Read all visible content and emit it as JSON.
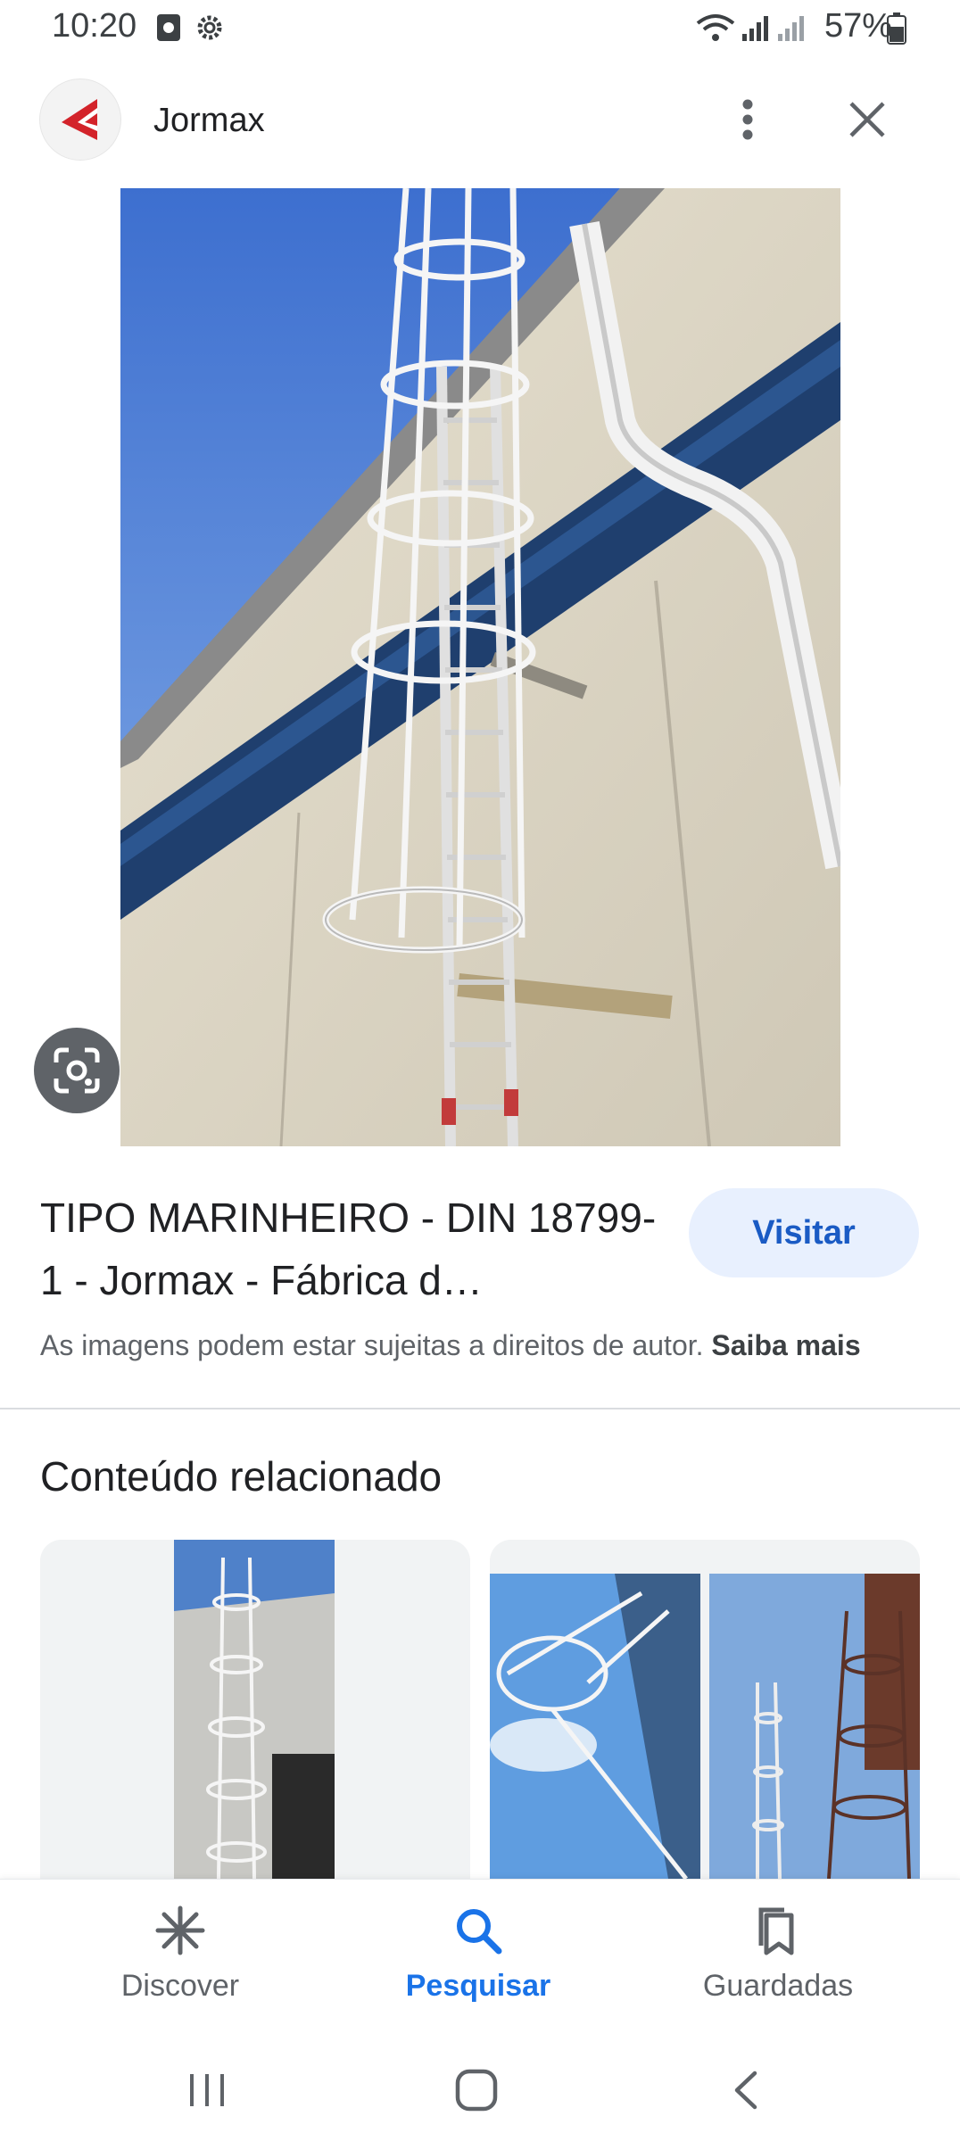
{
  "status_bar": {
    "time": "10:20",
    "battery": "57%",
    "icons": [
      "media-icon",
      "settings-gear-icon",
      "wifi-icon",
      "signal-icon",
      "signal-roaming-icon",
      "battery-icon"
    ]
  },
  "header": {
    "site_name": "Jormax",
    "logo_icon": "jormax-logo-icon",
    "more_icon": "more-vert-icon",
    "close_icon": "close-icon"
  },
  "main_image": {
    "subject": "caged ladder on building wall"
  },
  "result": {
    "title": "TIPO MARINHEIRO - DIN 18799-1 - Jormax - Fábrica d…",
    "visit_label": "Visitar",
    "copyright_text": "As imagens podem estar sujeitas a direitos de autor.",
    "copyright_link": "Saiba mais"
  },
  "related": {
    "heading": "Conteúdo relacionado"
  },
  "bottom_nav": {
    "items": [
      {
        "label": "Discover",
        "icon": "asterisk-icon"
      },
      {
        "label": "Pesquisar",
        "icon": "search-icon"
      },
      {
        "label": "Guardadas",
        "icon": "bookmarks-icon"
      }
    ]
  },
  "colors": {
    "accent": "#1a73e8",
    "visit_bg": "#e8f0fe",
    "logo_red": "#d3232a"
  }
}
